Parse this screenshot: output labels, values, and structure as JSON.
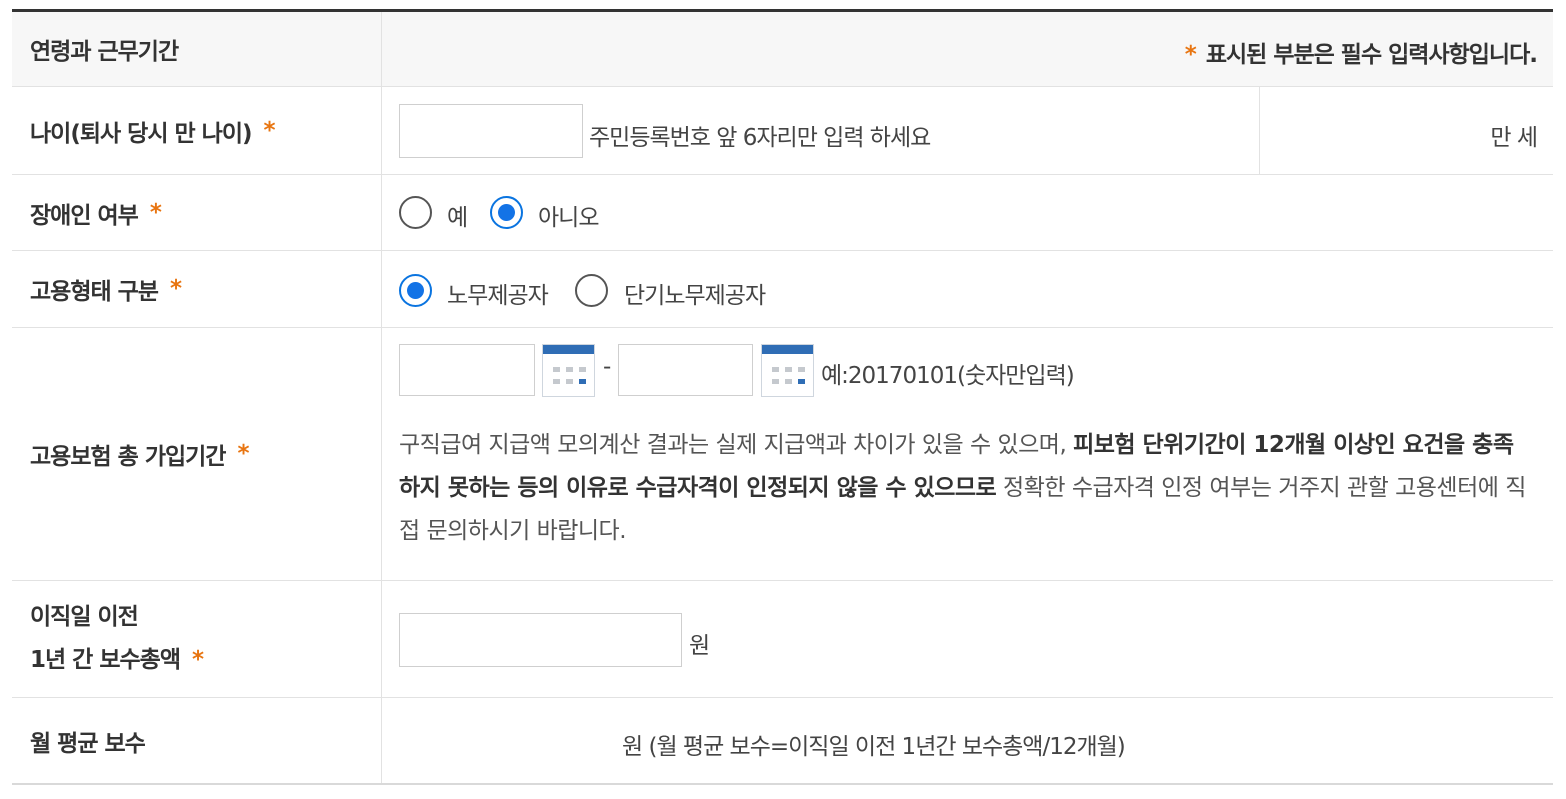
{
  "header": {
    "section_title": "연령과 근무기간",
    "required_star": "*",
    "required_note": "표시된 부분은 필수 입력사항입니다."
  },
  "age": {
    "label": "나이(퇴사 당시 만 나이)",
    "star": "*",
    "input_value": "",
    "hint": "주민등록번호 앞 6자리만 입력 하세요",
    "result": "만 세"
  },
  "disabled": {
    "label": "장애인 여부",
    "star": "*",
    "options": [
      {
        "label": "예",
        "selected": false
      },
      {
        "label": "아니오",
        "selected": true
      }
    ]
  },
  "employment_type": {
    "label": "고용형태 구분",
    "star": "*",
    "options": [
      {
        "label": "노무제공자",
        "selected": true
      },
      {
        "label": "단기노무제공자",
        "selected": false
      }
    ]
  },
  "insurance_period": {
    "label": "고용보험 총 가입기간",
    "star": "*",
    "start_value": "",
    "end_value": "",
    "separator": "-",
    "hint": "예:20170101(숫자만입력)",
    "notice_part1": "구직급여 지급액 모의계산 결과는 실제 지급액과 차이가 있을 수 있으며, ",
    "notice_bold": "피보험 단위기간이 12개월 이상인 요건을 충족하지 못하는 등의 이유로 수급자격이 인정되지 않을 수 있으므로",
    "notice_part2": " 정확한 수급자격 인정 여부는 거주지 관할 고용센터에 직접 문의하시기 바랍니다."
  },
  "total_pay": {
    "label_line1": "이직일 이전",
    "label_line2": "1년 간 보수총액",
    "star": "*",
    "input_value": "",
    "unit": "원"
  },
  "monthly_avg": {
    "label": "월 평균 보수",
    "text": "원 (월 평균 보수=이직일 이전 1년간 보수총액/12개월)"
  },
  "colors": {
    "accent_star": "#e87511",
    "radio_selected": "#1373e6",
    "calendar": "#2f6db5"
  },
  "icons": {
    "date_picker": "calendar-icon"
  }
}
